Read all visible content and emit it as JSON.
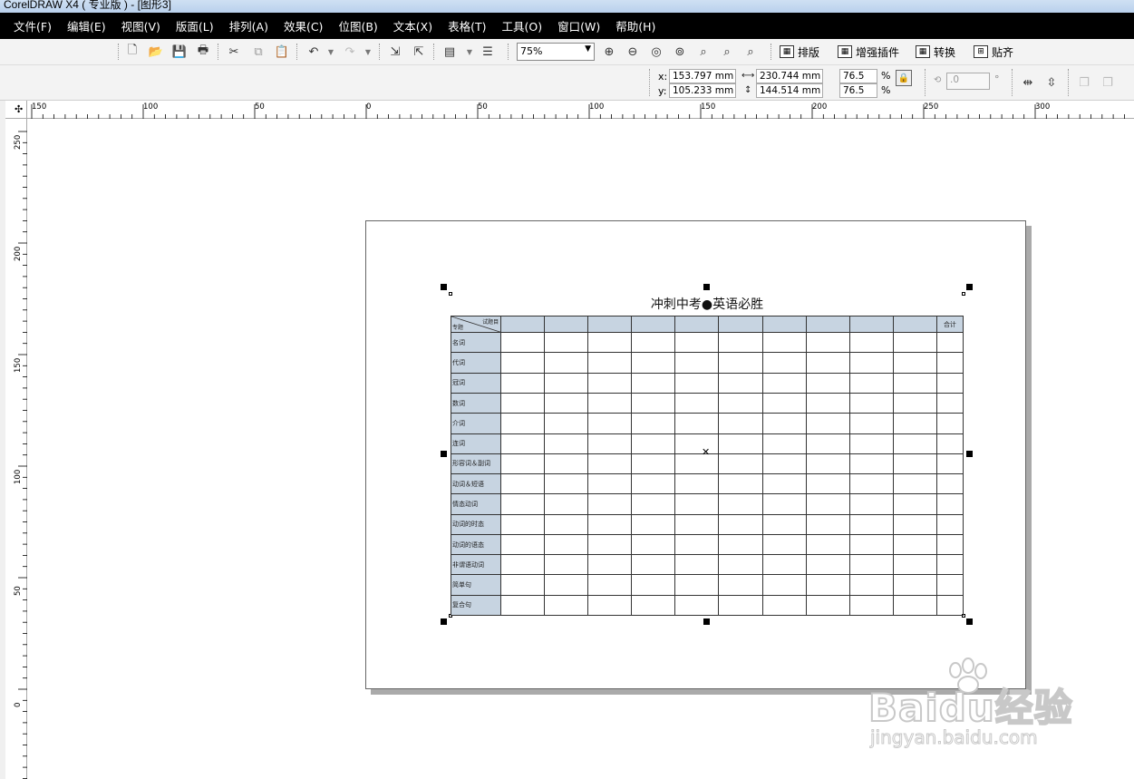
{
  "window": {
    "title": "CorelDRAW X4 ( 专业版 ) - [图形3]"
  },
  "menu": [
    "文件(F)",
    "编辑(E)",
    "视图(V)",
    "版面(L)",
    "排列(A)",
    "效果(C)",
    "位图(B)",
    "文本(X)",
    "表格(T)",
    "工具(O)",
    "窗口(W)",
    "帮助(H)"
  ],
  "toolbar": {
    "zoom_value": "75%",
    "plugins": [
      "排版",
      "增强插件",
      "转换",
      "贴齐"
    ]
  },
  "property_bar": {
    "x_label": "x:",
    "x_value": "153.797 mm",
    "y_label": "y:",
    "y_value": "105.233 mm",
    "width_value": "230.744 mm",
    "height_value": "144.514 mm",
    "scale_w": "76.5",
    "scale_h": "76.5",
    "percent": "%",
    "rotation_value": ".0",
    "degree": "°"
  },
  "rulers": {
    "horizontal": [
      "150",
      "100",
      "50",
      "0",
      "50",
      "100",
      "150",
      "200",
      "250",
      "300"
    ],
    "vertical": [
      "250",
      "200",
      "150",
      "100",
      "50",
      "0"
    ]
  },
  "document": {
    "title": "冲刺中考●英语必胜",
    "header_corner_top": "试题目",
    "header_corner_bottom": "专题",
    "total_label": "合计",
    "rows": [
      "名词",
      "代词",
      "冠词",
      "数词",
      "介词",
      "连词",
      "形容词＆副词",
      "动词＆短语",
      "情态动词",
      "动词的时态",
      "动词的语态",
      "非谓语动词",
      "简单句",
      "复合句"
    ]
  },
  "watermark": {
    "brand": "Baidu经验",
    "url": "jingyan.baidu.com"
  }
}
